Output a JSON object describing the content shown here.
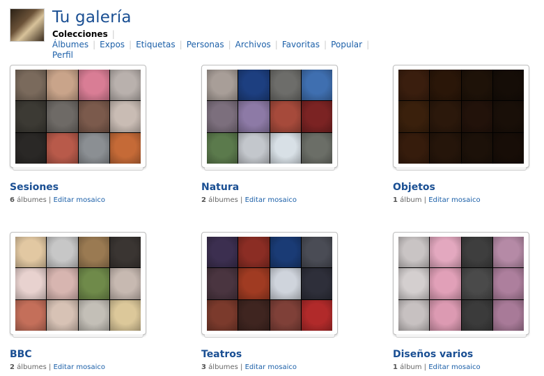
{
  "header": {
    "title": "Tu galería",
    "nav": [
      {
        "label": "Colecciones",
        "active": true
      },
      {
        "label": "Álbumes"
      },
      {
        "label": "Expos"
      },
      {
        "label": "Etiquetas"
      },
      {
        "label": "Personas"
      },
      {
        "label": "Archivos"
      },
      {
        "label": "Favoritas"
      },
      {
        "label": "Popular"
      },
      {
        "label": "Perfil"
      }
    ]
  },
  "collections": [
    {
      "title": "Sesiones",
      "count": "6",
      "unit": "álbumes",
      "edit": "Editar mosaico",
      "tiles": [
        "#7a6a5c",
        "#c9a48a",
        "#d97d95",
        "#b9b1ad",
        "#3c3a34",
        "#6e6a66",
        "#7b5a4c",
        "#c9bcb4",
        "#2a2826",
        "#b85a4a",
        "#8b8f93",
        "#c56a37"
      ]
    },
    {
      "title": "Natura",
      "count": "2",
      "unit": "álbumes",
      "edit": "Editar mosaico",
      "tiles": [
        "#a89e98",
        "#1d3f80",
        "#6d6d6a",
        "#3f6fb0",
        "#7c6f7d",
        "#8d7aa6",
        "#a64a3b",
        "#7b2323",
        "#5b7a4c",
        "#c3c7cc",
        "#d8e0e6",
        "#6b6e67"
      ]
    },
    {
      "title": "Objetos",
      "count": "1",
      "unit": "álbum",
      "edit": "Editar mosaico",
      "tiles": [
        "#3a1e0e",
        "#2a1608",
        "#1e1208",
        "#150d07",
        "#3a200c",
        "#2b180b",
        "#22120a",
        "#190f08",
        "#361c0c",
        "#25150a",
        "#1c1109",
        "#170d07"
      ]
    },
    {
      "title": "BBC",
      "count": "2",
      "unit": "álbumes",
      "edit": "Editar mosaico",
      "tiles": [
        "#e2c8a2",
        "#c7c7c7",
        "#9a7a52",
        "#3a3532",
        "#e8d2cf",
        "#d7b5b0",
        "#6f8a4a",
        "#c7b9b1",
        "#c46f5a",
        "#d7c2b5",
        "#c3bfb7",
        "#dcc89a"
      ]
    },
    {
      "title": "Teatros",
      "count": "3",
      "unit": "álbumes",
      "edit": "Editar mosaico",
      "tiles": [
        "#3c2f50",
        "#8b2d24",
        "#1a3b75",
        "#4a4c55",
        "#4a3540",
        "#a03b22",
        "#cfd4dc",
        "#2e2f3a",
        "#7b3a2c",
        "#3f2520",
        "#7f4038",
        "#b12a2a"
      ]
    },
    {
      "title": "Diseños varios",
      "count": "1",
      "unit": "álbum",
      "edit": "Editar mosaico",
      "tiles": [
        "#c9c4c4",
        "#e3a8bf",
        "#3e3e3e",
        "#b58aa6",
        "#d4cfcf",
        "#e1a0b8",
        "#4a4a4a",
        "#ad7f9d",
        "#c7c1c1",
        "#dc9ab2",
        "#3b3b3b",
        "#a87a98"
      ]
    }
  ]
}
